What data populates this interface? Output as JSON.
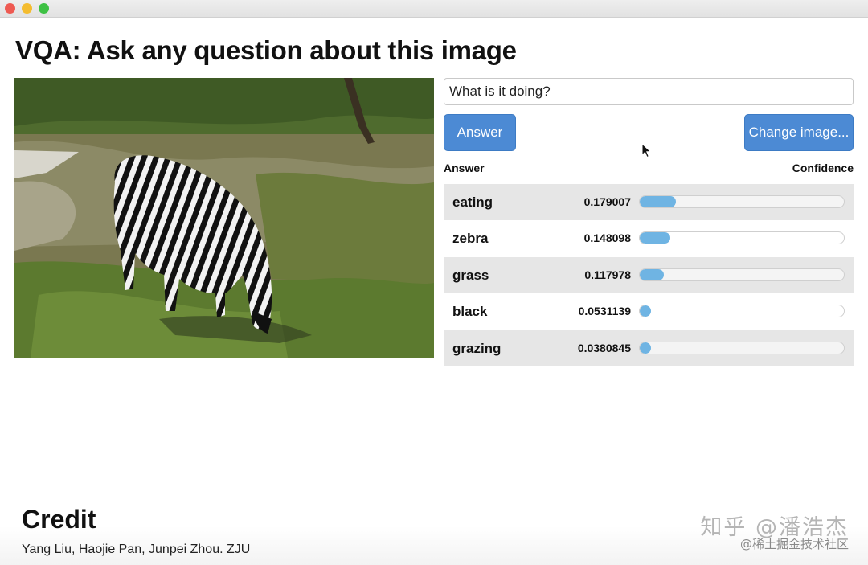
{
  "page": {
    "title": "VQA: Ask any question about this image"
  },
  "question": {
    "value": "What is it doing?"
  },
  "buttons": {
    "answer": "Answer",
    "change_image": "Change image..."
  },
  "table": {
    "header_answer": "Answer",
    "header_confidence": "Confidence",
    "rows": [
      {
        "label": "eating",
        "score": "0.179007",
        "level": 0.179007
      },
      {
        "label": "zebra",
        "score": "0.148098",
        "level": 0.148098
      },
      {
        "label": "grass",
        "score": "0.117978",
        "level": 0.117978
      },
      {
        "label": "black",
        "score": "0.0531139",
        "level": 0.0531139
      },
      {
        "label": "grazing",
        "score": "0.0380845",
        "level": 0.0380845
      }
    ]
  },
  "credit": {
    "title": "Credit",
    "text": "Yang Liu, Haojie Pan, Junpei Zhou. ZJU"
  },
  "watermark": {
    "line1": "知乎 @潘浩杰",
    "line2": "@稀土掘金技术社区"
  },
  "colors": {
    "button": "#4c8ad4",
    "bar_fill": "#6fb4e3",
    "row_shade": "#e6e6e6"
  },
  "icons": {
    "cursor": "cursor-arrow-icon"
  }
}
